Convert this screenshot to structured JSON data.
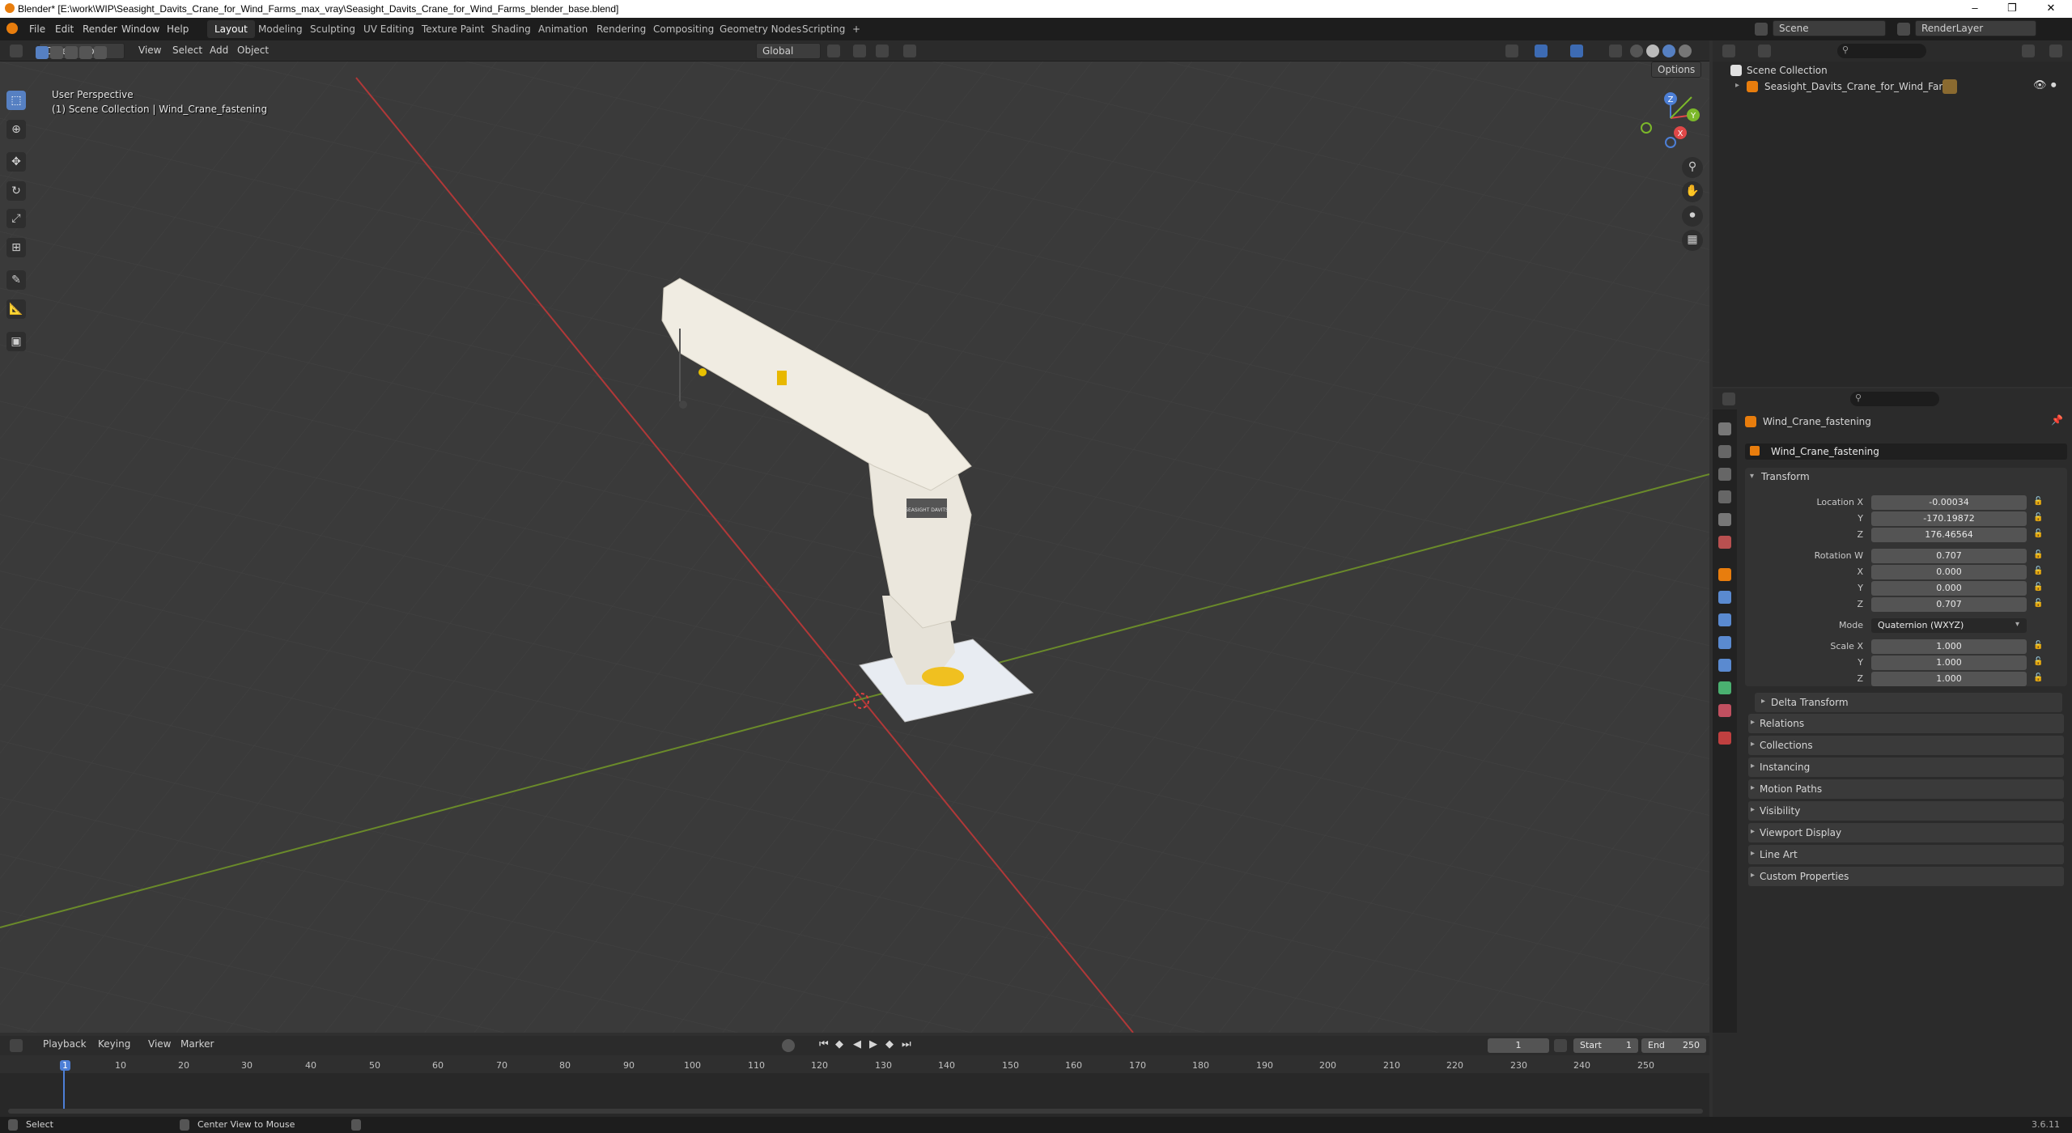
{
  "window": {
    "title": "Blender* [E:\\work\\WIP\\Seasight_Davits_Crane_for_Wind_Farms_max_vray\\Seasight_Davits_Crane_for_Wind_Farms_blender_base.blend]",
    "minimize": "–",
    "maximize": "❐",
    "close": "✕"
  },
  "menu": {
    "items": [
      "File",
      "Edit",
      "Render",
      "Window",
      "Help"
    ],
    "workspaces": [
      "Layout",
      "Modeling",
      "Sculpting",
      "UV Editing",
      "Texture Paint",
      "Shading",
      "Animation",
      "Rendering",
      "Compositing",
      "Geometry Nodes",
      "Scripting",
      "+"
    ],
    "scene": "Scene",
    "render_layer": "RenderLayer"
  },
  "viewport_header": {
    "mode": "Object Mode",
    "menus": [
      "View",
      "Select",
      "Add",
      "Object"
    ],
    "orientation": "Global",
    "options": "Options"
  },
  "viewport": {
    "perspective": "User Perspective",
    "collection_path": "(1) Scene Collection | Wind_Crane_fastening",
    "crane_label": "SEASIGHT DAVITS"
  },
  "gizmo": {
    "x": "X",
    "y": "Y",
    "z": "Z"
  },
  "outliner": {
    "root": "Scene Collection",
    "object": "Seasight_Davits_Crane_for_Wind_Farms"
  },
  "properties": {
    "object_name": "Wind_Crane_fastening",
    "data_name": "Wind_Crane_fastening",
    "transform_label": "Transform",
    "location": {
      "label": "Location X",
      "x": "-0.00034",
      "y": "-170.19872",
      "z": "176.46564"
    },
    "rotation": {
      "label": "Rotation W",
      "w": "0.707",
      "x": "0.000",
      "y": "0.000",
      "z": "0.707"
    },
    "mode": {
      "label": "Mode",
      "value": "Quaternion (WXYZ)"
    },
    "scale": {
      "label": "Scale X",
      "x": "1.000",
      "y": "1.000",
      "z": "1.000"
    },
    "axis_y": "Y",
    "axis_z": "Z",
    "axis_x": "X",
    "delta": "Delta Transform",
    "panels": [
      "Relations",
      "Collections",
      "Instancing",
      "Motion Paths",
      "Visibility",
      "Viewport Display",
      "Line Art",
      "Custom Properties"
    ]
  },
  "timeline": {
    "menus": [
      "Playback",
      "Keying",
      "View",
      "Marker"
    ],
    "current_frame": "1",
    "start_label": "Start",
    "start": "1",
    "end_label": "End",
    "end": "250",
    "ticks": [
      "1",
      "10",
      "20",
      "30",
      "40",
      "50",
      "60",
      "70",
      "80",
      "90",
      "100",
      "110",
      "120",
      "130",
      "140",
      "150",
      "160",
      "170",
      "180",
      "190",
      "200",
      "210",
      "220",
      "230",
      "240",
      "250"
    ]
  },
  "status": {
    "select": "Select",
    "center": "Center View to Mouse",
    "version": "3.6.11"
  }
}
